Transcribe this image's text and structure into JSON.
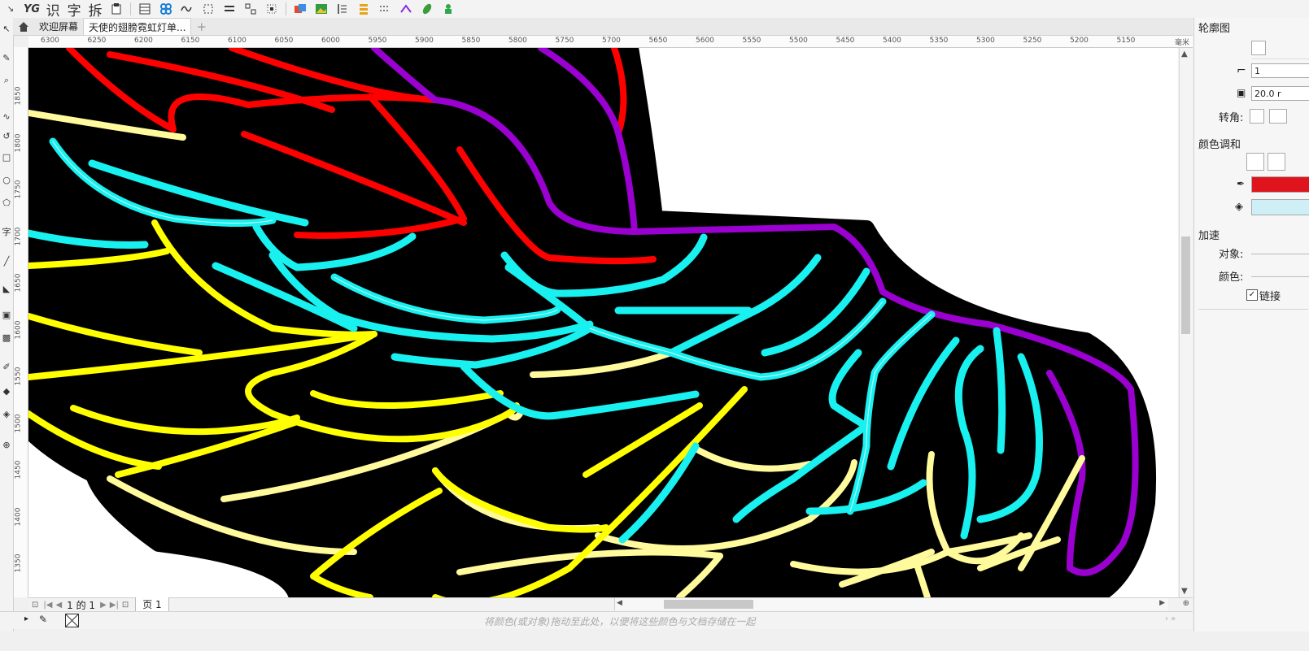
{
  "toolbar": {
    "yg": "YG",
    "chars": [
      "识",
      "字",
      "拆"
    ],
    "icons": [
      "table-icon",
      "pattern-icon",
      "wave-icon",
      "dashed-select-icon",
      "align-icon",
      "grid-select-icon",
      "scan-select-icon",
      "color-frame-icon",
      "image-icon",
      "text-layout-icon",
      "stack-icon",
      "dots-icon",
      "arrows-icon",
      "leaf-icon",
      "plugin-icon"
    ]
  },
  "tabs": {
    "welcome": "欢迎屏幕",
    "document": "天使的翅膀霓虹灯单...",
    "add": "+"
  },
  "ruler": {
    "unit": "毫米",
    "h_ticks": [
      "6300",
      "6250",
      "6200",
      "6150",
      "6100",
      "6050",
      "6000",
      "5950",
      "5900",
      "5850",
      "5800",
      "5750",
      "5700",
      "5650",
      "5600",
      "5550",
      "5500",
      "5450",
      "5400",
      "5350",
      "5300",
      "5250",
      "5200",
      "5150"
    ],
    "v_ticks": [
      "1850",
      "1800",
      "1750",
      "1700",
      "1650",
      "1600",
      "1550",
      "1500",
      "1450",
      "1400",
      "1350"
    ]
  },
  "page_nav": {
    "of_text": "1 的 1",
    "page_tab": "页 1"
  },
  "status": {
    "hint": "将颜色(或对象)拖动至此处，以便将这些颜色与文档存储在一起"
  },
  "panel": {
    "title": "轮廓图",
    "steps_value": "1",
    "offset_value": "20.0 r",
    "corner_label": "转角:",
    "color_blend_label": "颜色调和",
    "accel_label": "加速",
    "object_label": "对象:",
    "color_label": "颜色:",
    "link_label": "链接",
    "link_checked": true,
    "outline_color": "#e0141c",
    "fill_color": "#cdeff5"
  },
  "colors": {
    "neon_red": "#ff0000",
    "neon_purple": "#9a00d0",
    "neon_cyan": "#19f0f0",
    "neon_yellow": "#ffff00",
    "neon_pale_yellow": "#fffa9c",
    "backing": "#000000"
  }
}
